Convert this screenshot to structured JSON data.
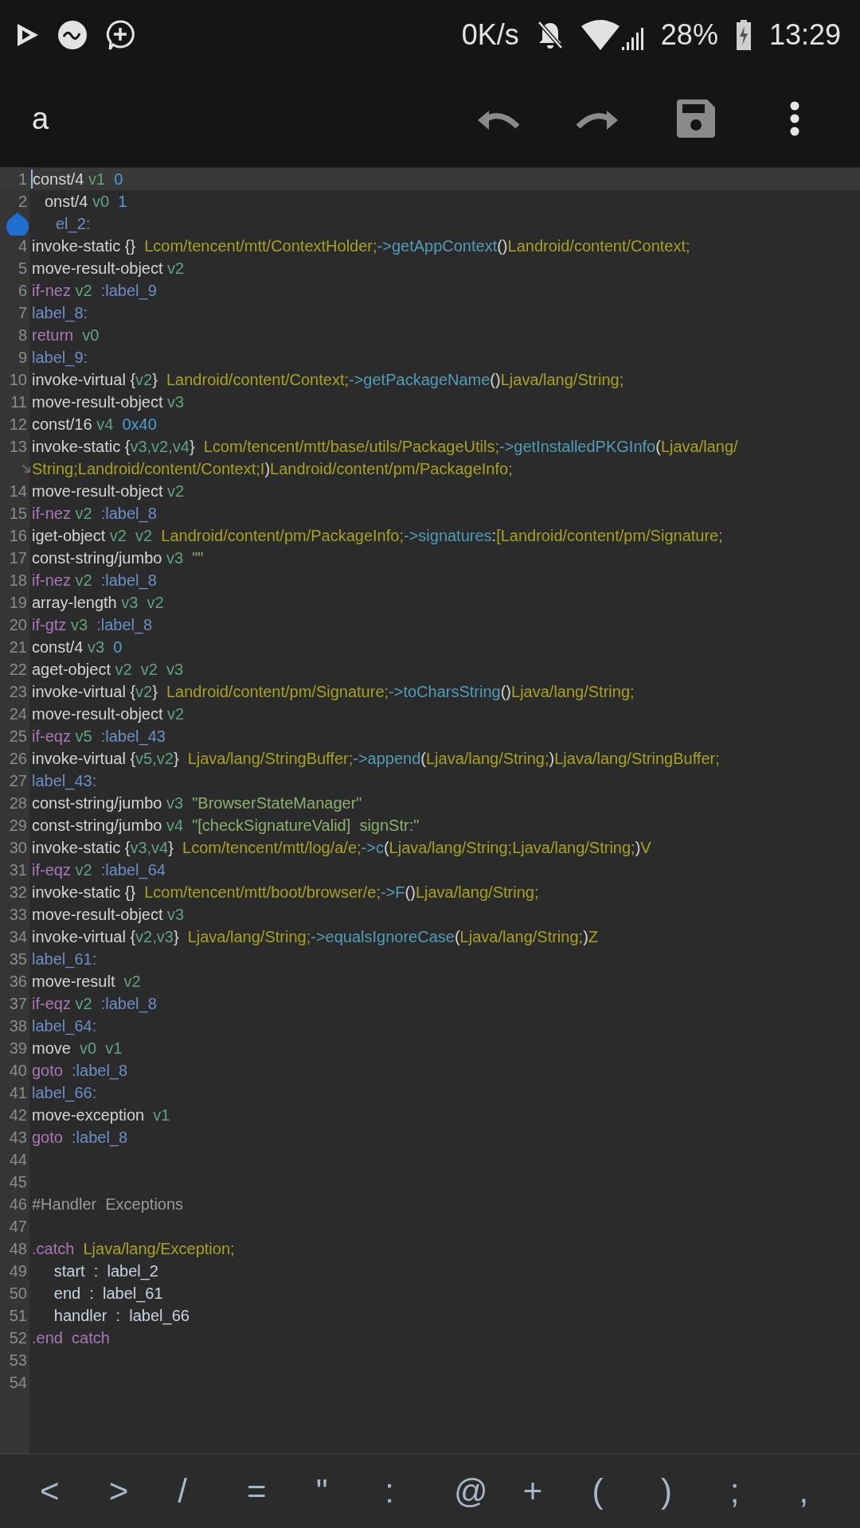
{
  "status_bar": {
    "speed": "0K/s",
    "battery": "28%",
    "time": "13:29"
  },
  "toolbar": {
    "title": "a"
  },
  "editor": {
    "lines": [
      {
        "number": "1",
        "current": true,
        "tokens": [
          {
            "text": "const/4",
            "kind": "plain"
          },
          {
            "text": " v1",
            "kind": "reg"
          },
          {
            "text": "  0",
            "kind": "num"
          }
        ]
      },
      {
        "number": "2",
        "current": false,
        "tokens": [
          {
            "text": "onst/4",
            "kind": "plain"
          },
          {
            "text": " v0",
            "kind": "reg"
          },
          {
            "text": "  1",
            "kind": "num"
          }
        ]
      },
      {
        "current": false,
        "tokens": [
          {
            "text": "el_2:",
            "kind": "label"
          }
        ]
      },
      {
        "number": "4",
        "current": false,
        "tokens": [
          {
            "text": "invoke-static {}",
            "kind": "plain"
          },
          {
            "text": "  Lcom/tencent/mtt/ContextHolder;",
            "kind": "type"
          },
          {
            "text": "->getAppContext",
            "kind": "method"
          },
          {
            "text": "()",
            "kind": "plain"
          },
          {
            "text": "Landroid/content/Context;",
            "kind": "type"
          }
        ]
      },
      {
        "number": "5",
        "current": false,
        "tokens": [
          {
            "text": "move-result-object",
            "kind": "plain"
          },
          {
            "text": " v2",
            "kind": "reg"
          }
        ]
      },
      {
        "number": "6",
        "current": false,
        "tokens": [
          {
            "text": "if-nez",
            "kind": "kw"
          },
          {
            "text": " v2",
            "kind": "reg"
          },
          {
            "text": "  :label_9",
            "kind": "label"
          }
        ]
      },
      {
        "number": "7",
        "current": false,
        "tokens": [
          {
            "text": "label_8:",
            "kind": "label"
          }
        ]
      },
      {
        "number": "8",
        "current": false,
        "tokens": [
          {
            "text": "return",
            "kind": "kw"
          },
          {
            "text": "  v0",
            "kind": "reg"
          }
        ]
      },
      {
        "number": "9",
        "current": false,
        "tokens": [
          {
            "text": "label_9:",
            "kind": "label"
          }
        ]
      },
      {
        "number": "10",
        "current": false,
        "tokens": [
          {
            "text": "invoke-virtual {",
            "kind": "plain"
          },
          {
            "text": "v2",
            "kind": "reg"
          },
          {
            "text": "}",
            "kind": "plain"
          },
          {
            "text": "  Landroid/content/Context;",
            "kind": "type"
          },
          {
            "text": "->getPackageName",
            "kind": "method"
          },
          {
            "text": "()",
            "kind": "plain"
          },
          {
            "text": "Ljava/lang/String;",
            "kind": "type"
          }
        ]
      },
      {
        "number": "11",
        "current": false,
        "tokens": [
          {
            "text": "move-result-object",
            "kind": "plain"
          },
          {
            "text": " v3",
            "kind": "reg"
          }
        ]
      },
      {
        "number": "12",
        "current": false,
        "tokens": [
          {
            "text": "const/16",
            "kind": "plain"
          },
          {
            "text": " v4",
            "kind": "reg"
          },
          {
            "text": "  0x40",
            "kind": "num"
          }
        ]
      },
      {
        "number": "13",
        "current": false,
        "tokens": [
          {
            "text": "invoke-static {",
            "kind": "plain"
          },
          {
            "text": "v3,v2,v4",
            "kind": "reg"
          },
          {
            "text": "}",
            "kind": "plain"
          },
          {
            "text": "  Lcom/tencent/mtt/base/utils/PackageUtils;",
            "kind": "type"
          },
          {
            "text": "->getInstalledPKGInfo",
            "kind": "method"
          },
          {
            "text": "(",
            "kind": "plain"
          },
          {
            "text": "Ljava/lang/",
            "kind": "type"
          }
        ],
        "continuation": [
          {
            "text": "String;Landroid/content/Context;I",
            "kind": "type"
          },
          {
            "text": ")",
            "kind": "plain"
          },
          {
            "text": "Landroid/content/pm/PackageInfo;",
            "kind": "type"
          }
        ]
      },
      {
        "number": "14",
        "current": false,
        "tokens": [
          {
            "text": "move-result-object",
            "kind": "plain"
          },
          {
            "text": " v2",
            "kind": "reg"
          }
        ]
      },
      {
        "number": "15",
        "current": false,
        "tokens": [
          {
            "text": "if-nez",
            "kind": "kw"
          },
          {
            "text": " v2",
            "kind": "reg"
          },
          {
            "text": "  :label_8",
            "kind": "label"
          }
        ]
      },
      {
        "number": "16",
        "current": false,
        "tokens": [
          {
            "text": "iget-object",
            "kind": "plain"
          },
          {
            "text": " v2  v2",
            "kind": "reg"
          },
          {
            "text": "  Landroid/content/pm/PackageInfo;",
            "kind": "type"
          },
          {
            "text": "->signatures",
            "kind": "method"
          },
          {
            "text": ":",
            "kind": "plain"
          },
          {
            "text": "[Landroid/content/pm/Signature;",
            "kind": "type"
          }
        ]
      },
      {
        "number": "17",
        "current": false,
        "tokens": [
          {
            "text": "const-string/jumbo",
            "kind": "plain"
          },
          {
            "text": " v3",
            "kind": "reg"
          },
          {
            "text": "  \"\"",
            "kind": "str"
          }
        ]
      },
      {
        "number": "18",
        "current": false,
        "tokens": [
          {
            "text": "if-nez",
            "kind": "kw"
          },
          {
            "text": " v2",
            "kind": "reg"
          },
          {
            "text": "  :label_8",
            "kind": "label"
          }
        ]
      },
      {
        "number": "19",
        "current": false,
        "tokens": [
          {
            "text": "array-length",
            "kind": "plain"
          },
          {
            "text": " v3  v2",
            "kind": "reg"
          }
        ]
      },
      {
        "number": "20",
        "current": false,
        "tokens": [
          {
            "text": "if-gtz",
            "kind": "kw"
          },
          {
            "text": " v3",
            "kind": "reg"
          },
          {
            "text": "  :label_8",
            "kind": "label"
          }
        ]
      },
      {
        "number": "21",
        "current": false,
        "tokens": [
          {
            "text": "const/4",
            "kind": "plain"
          },
          {
            "text": " v3",
            "kind": "reg"
          },
          {
            "text": "  0",
            "kind": "num"
          }
        ]
      },
      {
        "number": "22",
        "current": false,
        "tokens": [
          {
            "text": "aget-object",
            "kind": "plain"
          },
          {
            "text": " v2  v2  v3",
            "kind": "reg"
          }
        ]
      },
      {
        "number": "23",
        "current": false,
        "tokens": [
          {
            "text": "invoke-virtual {",
            "kind": "plain"
          },
          {
            "text": "v2",
            "kind": "reg"
          },
          {
            "text": "}",
            "kind": "plain"
          },
          {
            "text": "  Landroid/content/pm/Signature;",
            "kind": "type"
          },
          {
            "text": "->toCharsString",
            "kind": "method"
          },
          {
            "text": "()",
            "kind": "plain"
          },
          {
            "text": "Ljava/lang/String;",
            "kind": "type"
          }
        ]
      },
      {
        "number": "24",
        "current": false,
        "tokens": [
          {
            "text": "move-result-object",
            "kind": "plain"
          },
          {
            "text": " v2",
            "kind": "reg"
          }
        ]
      },
      {
        "number": "25",
        "current": false,
        "tokens": [
          {
            "text": "if-eqz",
            "kind": "kw"
          },
          {
            "text": " v5",
            "kind": "reg"
          },
          {
            "text": "  :label_43",
            "kind": "label"
          }
        ]
      },
      {
        "number": "26",
        "current": false,
        "tokens": [
          {
            "text": "invoke-virtual {",
            "kind": "plain"
          },
          {
            "text": "v5,v2",
            "kind": "reg"
          },
          {
            "text": "}",
            "kind": "plain"
          },
          {
            "text": "  Ljava/lang/StringBuffer;",
            "kind": "type"
          },
          {
            "text": "->append",
            "kind": "method"
          },
          {
            "text": "(",
            "kind": "plain"
          },
          {
            "text": "Ljava/lang/String;",
            "kind": "type"
          },
          {
            "text": ")",
            "kind": "plain"
          },
          {
            "text": "Ljava/lang/StringBuffer;",
            "kind": "type"
          }
        ]
      },
      {
        "number": "27",
        "current": false,
        "tokens": [
          {
            "text": "label_43:",
            "kind": "label"
          }
        ]
      },
      {
        "number": "28",
        "current": false,
        "tokens": [
          {
            "text": "const-string/jumbo",
            "kind": "plain"
          },
          {
            "text": " v3",
            "kind": "reg"
          },
          {
            "text": "  \"BrowserStateManager\"",
            "kind": "str"
          }
        ]
      },
      {
        "number": "29",
        "current": false,
        "tokens": [
          {
            "text": "const-string/jumbo",
            "kind": "plain"
          },
          {
            "text": " v4",
            "kind": "reg"
          },
          {
            "text": "  \"[checkSignatureValid]  signStr:\"",
            "kind": "str"
          }
        ]
      },
      {
        "number": "30",
        "current": false,
        "tokens": [
          {
            "text": "invoke-static {",
            "kind": "plain"
          },
          {
            "text": "v3,v4",
            "kind": "reg"
          },
          {
            "text": "}",
            "kind": "plain"
          },
          {
            "text": "  Lcom/tencent/mtt/log/a/e;",
            "kind": "type"
          },
          {
            "text": "->c",
            "kind": "method"
          },
          {
            "text": "(",
            "kind": "plain"
          },
          {
            "text": "Ljava/lang/String;Ljava/lang/String;",
            "kind": "type"
          },
          {
            "text": ")",
            "kind": "plain"
          },
          {
            "text": "V",
            "kind": "type"
          }
        ]
      },
      {
        "number": "31",
        "current": false,
        "tokens": [
          {
            "text": "if-eqz",
            "kind": "kw"
          },
          {
            "text": " v2",
            "kind": "reg"
          },
          {
            "text": "  :label_64",
            "kind": "label"
          }
        ]
      },
      {
        "number": "32",
        "current": false,
        "tokens": [
          {
            "text": "invoke-static {}",
            "kind": "plain"
          },
          {
            "text": "  Lcom/tencent/mtt/boot/browser/e;",
            "kind": "type"
          },
          {
            "text": "->F",
            "kind": "method"
          },
          {
            "text": "()",
            "kind": "plain"
          },
          {
            "text": "Ljava/lang/String;",
            "kind": "type"
          }
        ]
      },
      {
        "number": "33",
        "current": false,
        "tokens": [
          {
            "text": "move-result-object",
            "kind": "plain"
          },
          {
            "text": " v3",
            "kind": "reg"
          }
        ]
      },
      {
        "number": "34",
        "current": false,
        "tokens": [
          {
            "text": "invoke-virtual {",
            "kind": "plain"
          },
          {
            "text": "v2,v3",
            "kind": "reg"
          },
          {
            "text": "}",
            "kind": "plain"
          },
          {
            "text": "  Ljava/lang/String;",
            "kind": "type"
          },
          {
            "text": "->equalsIgnoreCase",
            "kind": "method"
          },
          {
            "text": "(",
            "kind": "plain"
          },
          {
            "text": "Ljava/lang/String;",
            "kind": "type"
          },
          {
            "text": ")",
            "kind": "plain"
          },
          {
            "text": "Z",
            "kind": "type"
          }
        ]
      },
      {
        "number": "35",
        "current": false,
        "tokens": [
          {
            "text": "label_61:",
            "kind": "label"
          }
        ]
      },
      {
        "number": "36",
        "current": false,
        "tokens": [
          {
            "text": "move-result",
            "kind": "plain"
          },
          {
            "text": "  v2",
            "kind": "reg"
          }
        ]
      },
      {
        "number": "37",
        "current": false,
        "tokens": [
          {
            "text": "if-eqz",
            "kind": "kw"
          },
          {
            "text": " v2",
            "kind": "reg"
          },
          {
            "text": "  :label_8",
            "kind": "label"
          }
        ]
      },
      {
        "number": "38",
        "current": false,
        "tokens": [
          {
            "text": "label_64:",
            "kind": "label"
          }
        ]
      },
      {
        "number": "39",
        "current": false,
        "tokens": [
          {
            "text": "move",
            "kind": "plain"
          },
          {
            "text": "  v0  v1",
            "kind": "reg"
          }
        ]
      },
      {
        "number": "40",
        "current": false,
        "tokens": [
          {
            "text": "goto",
            "kind": "kw"
          },
          {
            "text": "  :label_8",
            "kind": "label"
          }
        ]
      },
      {
        "number": "41",
        "current": false,
        "tokens": [
          {
            "text": "label_66:",
            "kind": "label"
          }
        ]
      },
      {
        "number": "42",
        "current": false,
        "tokens": [
          {
            "text": "move-exception",
            "kind": "plain"
          },
          {
            "text": "  v1",
            "kind": "reg"
          }
        ]
      },
      {
        "number": "43",
        "current": false,
        "tokens": [
          {
            "text": "goto",
            "kind": "kw"
          },
          {
            "text": "  :label_8",
            "kind": "label"
          }
        ]
      },
      {
        "number": "44",
        "current": false
      },
      {
        "number": "45",
        "current": false
      },
      {
        "number": "46",
        "current": false,
        "tokens": [
          {
            "text": "#Handler  Exceptions",
            "kind": "comment"
          }
        ]
      },
      {
        "number": "47",
        "current": false
      },
      {
        "number": "48",
        "current": false,
        "tokens": [
          {
            "text": ".catch",
            "kind": "kw"
          },
          {
            "text": "  Ljava/lang/Exception;",
            "kind": "type"
          }
        ]
      },
      {
        "number": "49",
        "current": false,
        "tokens": [
          {
            "text": "     start  :  label_2",
            "kind": "field"
          }
        ]
      },
      {
        "number": "50",
        "current": false,
        "tokens": [
          {
            "text": "     end  :  label_61",
            "kind": "field"
          }
        ]
      },
      {
        "number": "51",
        "current": false,
        "tokens": [
          {
            "text": "     handler  :  label_66",
            "kind": "field"
          }
        ]
      },
      {
        "number": "52",
        "current": false,
        "tokens": [
          {
            "text": ".end  catch",
            "kind": "kw"
          }
        ]
      },
      {
        "number": "53",
        "current": false
      },
      {
        "number": "54",
        "current": false
      }
    ]
  },
  "symbol_keys": [
    "<",
    ">",
    "/",
    "=",
    "\"",
    ":",
    "@",
    "+",
    "(",
    ")",
    ";",
    ","
  ]
}
